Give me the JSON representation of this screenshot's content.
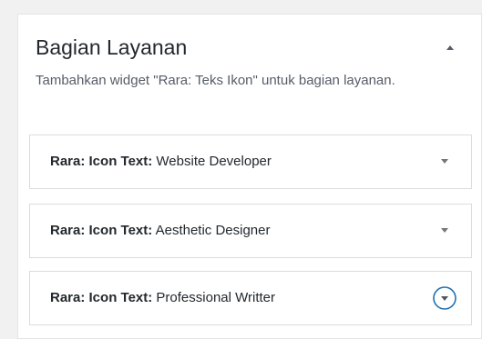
{
  "section": {
    "title": "Bagian Layanan",
    "description": "Tambahkan widget \"Rara: Teks Ikon\" untuk bagian layanan.",
    "toggle_icon": "triangle-up-icon"
  },
  "widgets": [
    {
      "prefix": "Rara: Icon Text:",
      "name": "Website Developer",
      "icon": "triangle-down-icon",
      "focused": false
    },
    {
      "prefix": "Rara: Icon Text:",
      "name": "Aesthetic Designer",
      "icon": "triangle-down-icon",
      "focused": false
    },
    {
      "prefix": "Rara: Icon Text:",
      "name": "Professional Writter",
      "icon": "circle-triangle-down-icon",
      "focused": true
    }
  ],
  "colors": {
    "background": "#f1f1f1",
    "panel": "#ffffff",
    "border": "#dcdcde",
    "text": "#23282d",
    "muted_text": "#555d66",
    "icon": "#72777c",
    "focus_ring": "#2271b1"
  }
}
